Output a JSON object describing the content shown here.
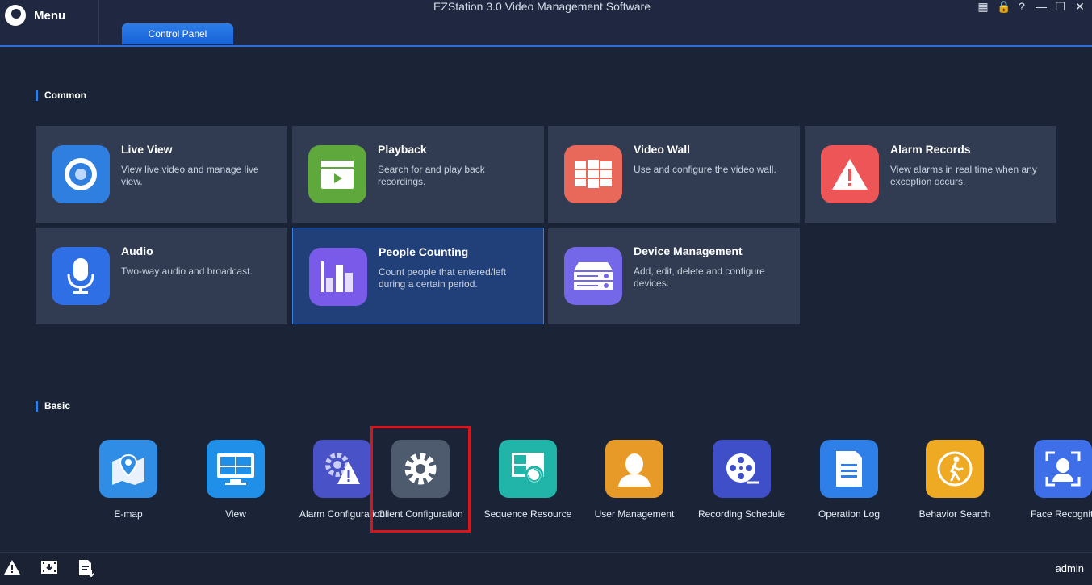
{
  "app": {
    "title": "EZStation 3.0 Video Management Software",
    "menu_label": "Menu",
    "tab_label": "Control Panel"
  },
  "window_controls": [
    "grid-icon",
    "lock-icon",
    "help-icon",
    "minimize-icon",
    "restore-icon",
    "close-icon"
  ],
  "sections": {
    "common_title": "Common",
    "basic_title": "Basic"
  },
  "common_cards": [
    {
      "title": "Live View",
      "desc": "View live video and manage live view.",
      "icon": "camera-eye-icon",
      "color": "#2f7fe0"
    },
    {
      "title": "Playback",
      "desc": "Search for and play back recordings.",
      "icon": "playback-clapper-icon",
      "color": "#5fa83c"
    },
    {
      "title": "Video Wall",
      "desc": "Use and configure the video wall.",
      "icon": "video-wall-icon",
      "color": "#e8695a"
    },
    {
      "title": "Alarm Records",
      "desc": "View alarms in real time when any exception occurs.",
      "icon": "warning-icon",
      "color": "#ee5556"
    },
    {
      "title": "Audio",
      "desc": "Two-way audio and broadcast.",
      "icon": "microphone-icon",
      "color": "#2f6fe6"
    },
    {
      "title": "People Counting",
      "desc": "Count people that entered/left during a certain period.",
      "icon": "bar-chart-icon",
      "color": "#7a5ae8"
    },
    {
      "title": "Device Management",
      "desc": "Add, edit, delete and configure devices.",
      "icon": "device-server-icon",
      "color": "#7468e8"
    }
  ],
  "basic_items": [
    {
      "label": "E-map",
      "icon": "map-pin-icon",
      "color": "#2f8de6"
    },
    {
      "label": "View",
      "icon": "monitor-icon",
      "color": "#1f8fe8"
    },
    {
      "label": "Alarm Configuration",
      "icon": "alarm-config-icon",
      "color": "#4a52c8"
    },
    {
      "label": "Client Configuration",
      "icon": "gear-icon",
      "color": "#4e5a6e"
    },
    {
      "label": "Sequence Resource",
      "icon": "sequence-icon",
      "color": "#20b5a8"
    },
    {
      "label": "User Management",
      "icon": "user-icon",
      "color": "#e89a28"
    },
    {
      "label": "Recording Schedule",
      "icon": "film-reel-icon",
      "color": "#3f4fc8"
    },
    {
      "label": "Operation Log",
      "icon": "document-icon",
      "color": "#2f7fe8"
    },
    {
      "label": "Behavior Search",
      "icon": "walking-person-icon",
      "color": "#eeaa22"
    },
    {
      "label": "Face Recogniti",
      "icon": "face-scan-icon",
      "color": "#3f6fe8"
    }
  ],
  "bottom": {
    "icons": [
      "alert-icon",
      "download-video-icon",
      "export-log-icon"
    ],
    "user": "admin"
  }
}
